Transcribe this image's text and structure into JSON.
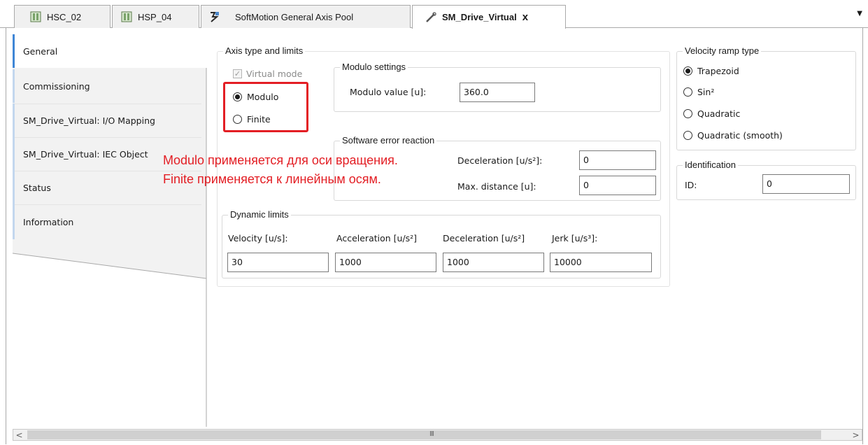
{
  "tabs": [
    {
      "label": "HSC_02",
      "icon": "device-icon"
    },
    {
      "label": "HSP_04",
      "icon": "device-icon"
    },
    {
      "label": "SoftMotion General Axis Pool",
      "icon": "axis-pool-icon"
    },
    {
      "label": "SM_Drive_Virtual",
      "icon": "drive-icon",
      "active": true,
      "close": "x"
    }
  ],
  "tab_dropdown": "▼",
  "nav": {
    "items": [
      {
        "label": "General",
        "active": true
      },
      {
        "label": "Commissioning"
      },
      {
        "label": "SM_Drive_Virtual: I/O Mapping"
      },
      {
        "label": "SM_Drive_Virtual: IEC Object"
      },
      {
        "label": "Status"
      },
      {
        "label": "Information"
      }
    ]
  },
  "axis_type": {
    "title": "Axis type and limits",
    "virtual_mode": {
      "label": "Virtual mode",
      "checked": true,
      "disabled": true
    },
    "modulo": {
      "label": "Modulo",
      "selected": true
    },
    "finite": {
      "label": "Finite",
      "selected": false
    }
  },
  "modulo_settings": {
    "title": "Modulo settings",
    "value_label": "Modulo value [u]:",
    "value": "360.0"
  },
  "software_error": {
    "title": "Software error reaction",
    "decel_label": "Deceleration [u/s²]:",
    "decel_value": "0",
    "maxdist_label": "Max. distance [u]:",
    "maxdist_value": "0"
  },
  "dynamic_limits": {
    "title": "Dynamic limits",
    "velocity_label": "Velocity [u/s]:",
    "velocity_value": "30",
    "accel_label": "Acceleration [u/s²]",
    "accel_value": "1000",
    "decel_label": "Deceleration [u/s²]",
    "decel_value": "1000",
    "jerk_label": "Jerk [u/s³]:",
    "jerk_value": "10000"
  },
  "velocity_ramp": {
    "title": "Velocity ramp type",
    "options": [
      {
        "label": "Trapezoid",
        "selected": true
      },
      {
        "label": "Sin²",
        "selected": false
      },
      {
        "label": "Quadratic",
        "selected": false
      },
      {
        "label": "Quadratic (smooth)",
        "selected": false
      }
    ]
  },
  "identification": {
    "title": "Identification",
    "id_label": "ID:",
    "id_value": "0"
  },
  "annotation": {
    "line1": "Modulo применяется для оси вращения.",
    "line2": "Finite применяется к линейным осям.",
    "color": "#e31e24"
  },
  "scrollbar": {
    "left": "<",
    "right": ">",
    "grip": "III"
  }
}
